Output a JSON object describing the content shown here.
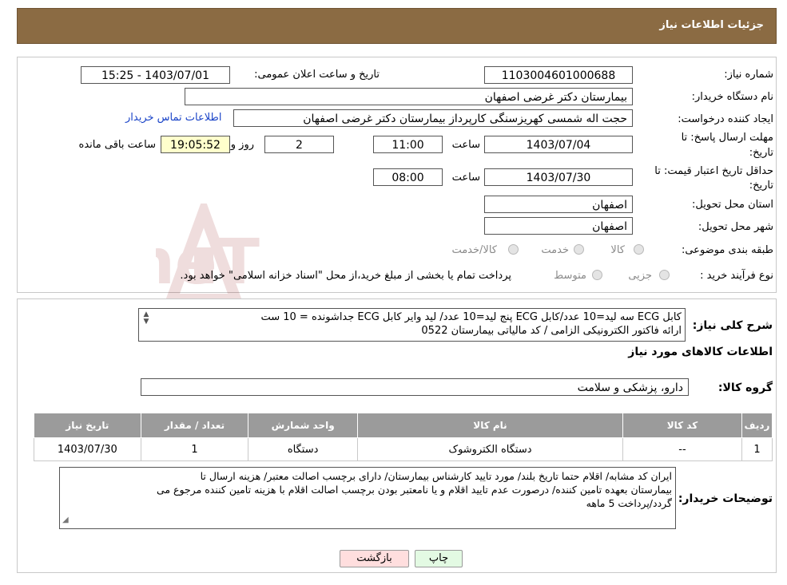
{
  "header": {
    "title": "جزئیات اطلاعات نیاز"
  },
  "info": {
    "need_number_label": "شماره نیاز:",
    "need_number": "1103004601000688",
    "announce_label": "تاریخ و ساعت اعلان عمومی:",
    "announce_value": "1403/07/01 - 15:25",
    "buyer_label": "نام دستگاه خریدار:",
    "buyer_value": "بیمارستان دکتر غرضی اصفهان",
    "creator_label": "ایجاد کننده درخواست:",
    "creator_value": "حجت اله شمسی کهریزسنگی کارپرداز بیمارستان دکتر غرضی اصفهان",
    "contact_link": "اطلاعات تماس خریدار",
    "deadline_label_1": "مهلت ارسال پاسخ: تا",
    "deadline_label_2": "تاریخ:",
    "deadline_date": "1403/07/04",
    "time_label": "ساعت",
    "deadline_time": "11:00",
    "days_value": "2",
    "days_label": "روز و",
    "remaining_value": "19:05:52",
    "remaining_label": "ساعت باقی مانده",
    "validity_label_1": "حداقل تاریخ اعتبار قیمت: تا",
    "validity_label_2": "تاریخ:",
    "validity_date": "1403/07/30",
    "validity_time": "08:00",
    "province_label": "استان محل تحویل:",
    "province_value": "اصفهان",
    "city_label": "شهر محل تحویل:",
    "city_value": "اصفهان",
    "category_label": "طبقه بندی موضوعی:",
    "category_options": [
      "کالا",
      "خدمت",
      "کالا/خدمت"
    ],
    "purchase_label": "نوع فرآیند خرید :",
    "purchase_options": [
      "جزیی",
      "متوسط"
    ],
    "purchase_note": "پرداخت تمام یا بخشی از مبلغ خرید،از محل \"اسناد خزانه اسلامی\" خواهد بود."
  },
  "watermark": {
    "text": "AriaTender.neT"
  },
  "summary": {
    "label": "شرح کلی نیاز:",
    "line1": "کابل ECG سه لید=10 عدد/کابل ECG پنج لید=10 عدد/ لید وایر کابل ECG جداشونده = 10 ست",
    "line2": "ارائه فاکتور الکترونیکی الزامی / کد مالیاتی بیمارستان 0522"
  },
  "goods": {
    "section_title": "اطلاعات کالاهای مورد نیاز",
    "group_label": "گروه کالا:",
    "group_value": "دارو، پزشکی و سلامت"
  },
  "table": {
    "headers": [
      "ردیف",
      "کد کالا",
      "نام کالا",
      "واحد شمارش",
      "تعداد / مقدار",
      "تاریخ نیاز"
    ],
    "rows": [
      [
        "1",
        "--",
        "دستگاه الکتروشوک",
        "دستگاه",
        "1",
        "1403/07/30"
      ]
    ]
  },
  "notes": {
    "label": "توضیحات خریدار:",
    "line1": "ایران کد مشابه/ اقلام حتما تاریخ بلند/ مورد تایید کارشناس بیمارستان/ دارای برچسب اصالت معتبر/ هزینه ارسال تا",
    "line2": "بیمارستان بعهده تامین کننده/ درصورت عدم تایید اقلام و یا نامعتبر بودن برچسب اصالت اقلام با هزینه تامین کننده مرجوع می",
    "line3": "گردد/پرداخت 5 ماهه"
  },
  "buttons": {
    "print": "چاپ",
    "back": "بازگشت"
  },
  "colors": {
    "header_bg": "#8b6b43",
    "link": "#1a44c8",
    "back_bg": "#ffdede",
    "print_bg": "#e3fae3",
    "table_header": "#9b9b9b"
  }
}
